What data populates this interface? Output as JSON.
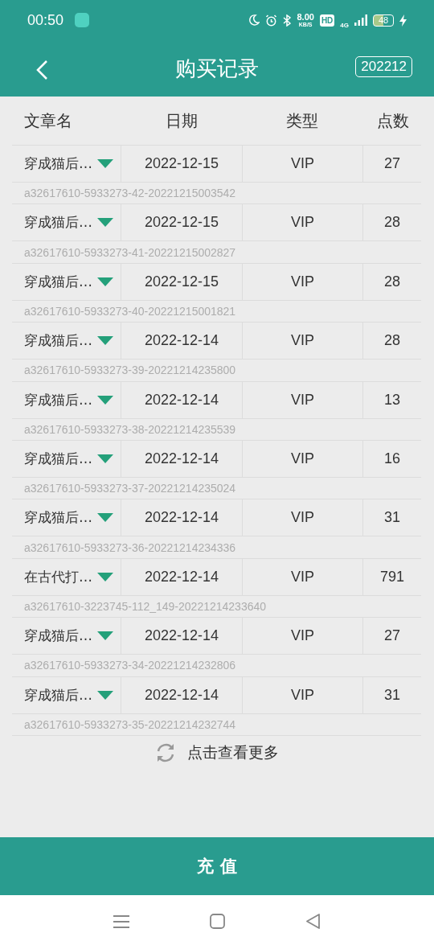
{
  "status_bar": {
    "time": "00:50",
    "speed_value": "8.00",
    "speed_unit": "KB/S",
    "hd": "HD",
    "network": "4G",
    "battery": "48"
  },
  "header": {
    "title": "购买记录",
    "month": "202212"
  },
  "table": {
    "columns": [
      "文章名",
      "日期",
      "类型",
      "点数"
    ],
    "rows": [
      {
        "name": "穿成猫后…",
        "date": "2022-12-15",
        "type": "VIP",
        "points": "27",
        "order_id": "a32617610-5933273-42-20221215003542"
      },
      {
        "name": "穿成猫后…",
        "date": "2022-12-15",
        "type": "VIP",
        "points": "28",
        "order_id": "a32617610-5933273-41-20221215002827"
      },
      {
        "name": "穿成猫后…",
        "date": "2022-12-15",
        "type": "VIP",
        "points": "28",
        "order_id": "a32617610-5933273-40-20221215001821"
      },
      {
        "name": "穿成猫后…",
        "date": "2022-12-14",
        "type": "VIP",
        "points": "28",
        "order_id": "a32617610-5933273-39-20221214235800"
      },
      {
        "name": "穿成猫后…",
        "date": "2022-12-14",
        "type": "VIP",
        "points": "13",
        "order_id": "a32617610-5933273-38-20221214235539"
      },
      {
        "name": "穿成猫后…",
        "date": "2022-12-14",
        "type": "VIP",
        "points": "16",
        "order_id": "a32617610-5933273-37-20221214235024"
      },
      {
        "name": "穿成猫后…",
        "date": "2022-12-14",
        "type": "VIP",
        "points": "31",
        "order_id": "a32617610-5933273-36-20221214234336"
      },
      {
        "name": "在古代打…",
        "date": "2022-12-14",
        "type": "VIP",
        "points": "791",
        "order_id": "a32617610-3223745-112_149-20221214233640"
      },
      {
        "name": "穿成猫后…",
        "date": "2022-12-14",
        "type": "VIP",
        "points": "27",
        "order_id": "a32617610-5933273-34-20221214232806"
      },
      {
        "name": "穿成猫后…",
        "date": "2022-12-14",
        "type": "VIP",
        "points": "31",
        "order_id": "a32617610-5933273-35-20221214232744"
      }
    ]
  },
  "load_more": "点击查看更多",
  "recharge_button": "充 值"
}
